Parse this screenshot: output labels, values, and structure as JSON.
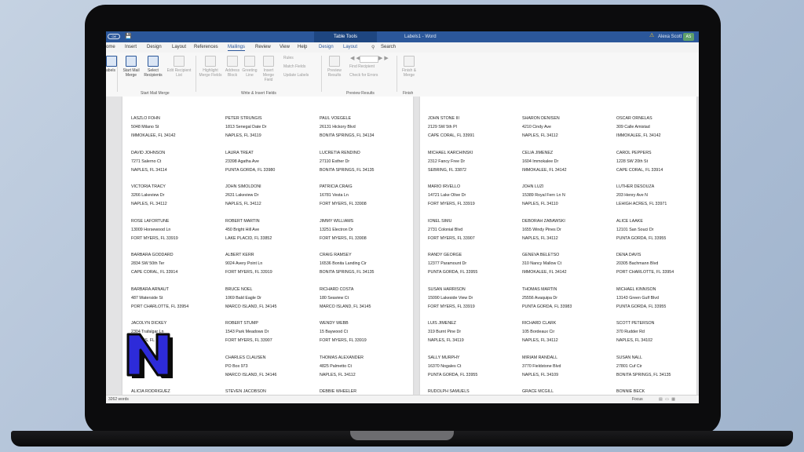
{
  "titlebar": {
    "autosave_label": "Off",
    "contextual_tab_group": "Table Tools",
    "document_title": "Labels1 - Word",
    "user_name": "Alexa Scott",
    "user_initials": "AS"
  },
  "tabs": [
    {
      "label": "ome"
    },
    {
      "label": "Insert"
    },
    {
      "label": "Design"
    },
    {
      "label": "Layout"
    },
    {
      "label": "References"
    },
    {
      "label": "Mailings",
      "active": true
    },
    {
      "label": "Review"
    },
    {
      "label": "View"
    },
    {
      "label": "Help"
    },
    {
      "label": "Design"
    },
    {
      "label": "Layout"
    }
  ],
  "search_label": "Search",
  "ribbon": {
    "buttons": {
      "labels": "abels",
      "start_mail_merge": "Start Mail Merge",
      "select_recipients": "Select Recipients",
      "edit_recipient_list": "Edit Recipient List",
      "highlight_merge_fields": "Highlight Merge Fields",
      "address_block": "Address Block",
      "greeting_line": "Greeting Line",
      "insert_merge_field": "Insert Merge Field",
      "rules": "Rules",
      "match_fields": "Match Fields",
      "update_labels": "Update Labels",
      "preview_results": "Preview Results",
      "find_recipient": "Find Recipient",
      "check_for_errors": "Check for Errors",
      "finish_merge": "Finish & Merge"
    },
    "groups": {
      "start_mail_merge": "Start Mail Merge",
      "write_insert_fields": "Write & Insert Fields",
      "preview_results": "Preview Results",
      "finish": "Finish"
    }
  },
  "labels_left": [
    [
      [
        "LASZLO FOHN",
        "5048 Milano St",
        "IMMOKALEE, FL  34142"
      ],
      [
        "DAVID JOHNSON",
        "7271 Salerno Ct",
        "NAPLES, FL  34114"
      ],
      [
        "VICTORIA TRACY",
        "3266 Lakeview Dr",
        "NAPLES, FL  34112"
      ],
      [
        "ROSE LAFORTUNE",
        "13009 Horsewood Ln",
        "FORT MYERS, FL  33919"
      ],
      [
        "BARBARA GODDARD",
        "2834 SW 50th Ter",
        "CAPE CORAL, FL  33914"
      ],
      [
        "BARBARA ARNAUT",
        "487 Waterside St",
        "PORT CHARLOTTE, FL  33954"
      ],
      [
        "JACOLYN DICKEY",
        "2304 Trafalgar Ln",
        "NAPLES, FL  34119"
      ],
      [
        "",
        "",
        ""
      ],
      [
        "ALICIA RODRIGUEZ",
        "",
        ""
      ]
    ],
    [
      [
        "PETER STRUNGIS",
        "1813 Senegal Date Dr",
        "NAPLES, FL  34119"
      ],
      [
        "LAURA TREAT",
        "23398 Agatha Ave",
        "PUNTA GORDA, FL  33980"
      ],
      [
        "JOHN SIMOLDONI",
        "2631 Lakeview Dr",
        "NAPLES, FL  34112"
      ],
      [
        "ROBERT MARTIN",
        "450 Bright Hill Ave",
        "LAKE PLACID, FL  33852"
      ],
      [
        "ALBERT KERR",
        "9024 Avery Point Ln",
        "FORT MYERS, FL  33919"
      ],
      [
        "BRUCE NOEL",
        "1069 Bald Eagle Dr",
        "MARCO ISLAND, FL  34145"
      ],
      [
        "ROBERT STUMP",
        "1543 Park Meadows Dr",
        "FORT MYERS, FL  33907"
      ],
      [
        "CHARLES CLAUSEN",
        "PO Box 973",
        "MARCO ISLAND, FL  34146"
      ],
      [
        "STEVEN JACOBSON",
        "",
        ""
      ]
    ],
    [
      [
        "PAUL VOEGELE",
        "26131 Hickory Blvd",
        "BONITA SPRINGS, FL  34134"
      ],
      [
        "LUCRETIA RENDINO",
        "27110 Esther Dr",
        "BONITA SPRINGS, FL  34135"
      ],
      [
        "PATRICIA CRAIG",
        "16781 Vesta Ln",
        "FORT MYERS, FL  33908"
      ],
      [
        "JIMMY WILLIAMS",
        "13251 Electron Dr",
        "FORT MYERS, FL  33908"
      ],
      [
        "CRAIG RAMSEY",
        "16536 Bonita Landing Cir",
        "BONITA SPRINGS, FL  34135"
      ],
      [
        "RICHARD COSTA",
        "180 Seaview Ct",
        "MARCO ISLAND, FL  34145"
      ],
      [
        "WENDY WEBB",
        "15 Baywood Ct",
        "FORT MYERS, FL  33919"
      ],
      [
        "THOMAS ALEXANDER",
        "4825 Palmetto Ct",
        "NAPLES, FL  34112"
      ],
      [
        "DEBBIE WHEELER",
        "",
        ""
      ]
    ]
  ],
  "labels_right": [
    [
      [
        "JOHN STONE III",
        "2129 SW 5th Pl",
        "CAPE CORAL, FL  33991"
      ],
      [
        "MICHAEL KARCHINSKI",
        "2312 Fancy Free Dr",
        "SEBRING, FL  33872"
      ],
      [
        "MARIO IRVELLO",
        "14721 Lake Olive Dr",
        "FORT MYERS, FL  33919"
      ],
      [
        "IONEL SIMU",
        "2731 Colonial Blvd",
        "FORT MYERS, FL  33907"
      ],
      [
        "RANDY GEORGE",
        "12377 Paramount Dr",
        "PUNTA GORDA, FL  33955"
      ],
      [
        "SUSAN HARRISON",
        "15090 Lakeside View Dr",
        "FORT MYERS, FL  33919"
      ],
      [
        "LUIS JIMENEZ",
        "319 Burnt Pine Dr",
        "NAPLES, FL  34119"
      ],
      [
        "SALLY MURPHY",
        "16370 Nogales Ct",
        "PUNTA GORDA, FL  33955"
      ],
      [
        "RUDOLPH SAMUELS",
        "",
        ""
      ]
    ],
    [
      [
        "SHARON DENISEN",
        "4210 Cindy Ave",
        "NAPLES, FL  34112"
      ],
      [
        "CELIA JIMENEZ",
        "1604 Immokalee Dr",
        "IMMOKALEE, FL  34142"
      ],
      [
        "JOHN LUZI",
        "15389 Royal Fern Ln N",
        "NAPLES, FL  34110"
      ],
      [
        "DEBORAH ZABAWSKI",
        "1655 Windy Pines Dr",
        "NAPLES, FL  34112"
      ],
      [
        "GENEVA BELETSO",
        "310 Nancy Mallow Ct",
        "IMMOKALEE, FL  34142"
      ],
      [
        "THOMAS MARTIN",
        "25556 Avaquipa Dr",
        "PUNTA GORDA, FL  33983"
      ],
      [
        "RICHARD CLARK",
        "105 Bordeaux Cir",
        "NAPLES, FL  34112"
      ],
      [
        "MIRIAM RANDALL",
        "3770 Fieldstone Blvd",
        "NAPLES, FL  34109"
      ],
      [
        "GRACE MCGILL",
        "",
        ""
      ]
    ],
    [
      [
        "OSCAR ORNELAS",
        "309 Calle Amistad",
        "IMMOKALEE, FL  34142"
      ],
      [
        "CAROL PEPPERS",
        "1228 SW 20th St",
        "CAPE CORAL, FL  33914"
      ],
      [
        "LUTHER DESOUZA",
        "203 Henry Ave N",
        "LEHIGH ACRES, FL  33971"
      ],
      [
        "ALICE LAAKE",
        "12101 San Souci Dr",
        "PUNTA GORDA, FL  33955"
      ],
      [
        "DENA DAVIS",
        "20305 Bachmann Blvd",
        "PORT CHARLOTTE, FL  33954"
      ],
      [
        "MICHAEL KINNISON",
        "13143 Green Gulf Blvd",
        "PUNTA GORDA, FL  33955"
      ],
      [
        "SCOTT PETERSON",
        "370 Rudder Rd",
        "NAPLES, FL  34102"
      ],
      [
        "SUSAN NALL",
        "27801 Cuf Cir",
        "BONITA SPRINGS, FL  34135"
      ],
      [
        "BONNIE BECK",
        "",
        ""
      ]
    ]
  ],
  "statusbar": {
    "word_count": "3262 words",
    "focus_label": "Focus"
  },
  "logo": {
    "letter": "N",
    "fill": "#2d2bd9",
    "outline": "#0a0a0a"
  },
  "colors": {
    "word_blue": "#2b579a",
    "avatar": "#5fa06a"
  }
}
